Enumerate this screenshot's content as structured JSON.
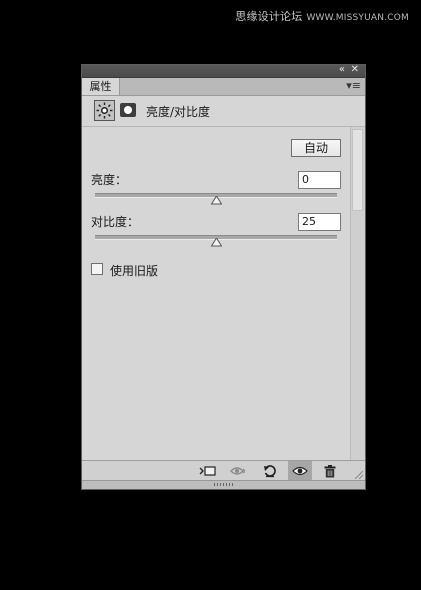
{
  "watermark": {
    "text": "思缘设计论坛",
    "site": "WWW.MISSYUAN.COM"
  },
  "titlebar": {
    "collapse_icon": "double-chevron-icon",
    "close_icon": "close-icon"
  },
  "tab": {
    "label": "属性"
  },
  "header": {
    "title": "亮度/对比度",
    "adjustment_icon": "brightness-contrast-icon",
    "mask_icon": "layer-mask-icon"
  },
  "controls": {
    "auto_label": "自动",
    "brightness": {
      "label": "亮度：",
      "value": "0",
      "slider_min": -150,
      "slider_max": 150
    },
    "contrast": {
      "label": "对比度：",
      "value": "25",
      "slider_min": -50,
      "slider_max": 100
    },
    "legacy": {
      "label": "使用旧版",
      "checked": false
    }
  },
  "bottom_tools": [
    "clip-to-layer-icon",
    "view-previous-state-icon",
    "reset-icon",
    "toggle-visibility-icon",
    "delete-icon"
  ]
}
